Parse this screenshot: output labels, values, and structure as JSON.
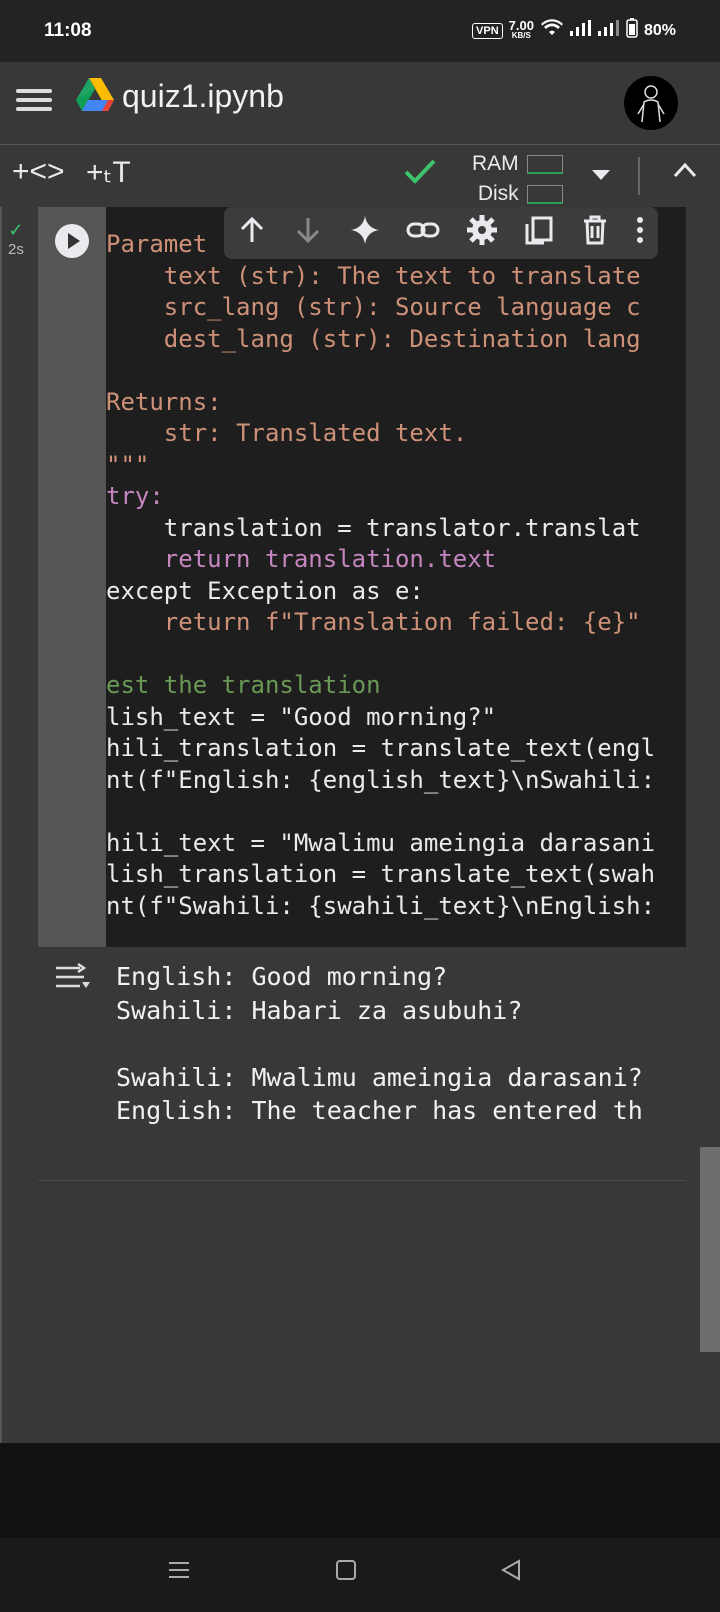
{
  "status_bar": {
    "time": "11:08",
    "vpn": "VPN",
    "speed_value": "7.00",
    "speed_unit": "KB/S",
    "battery": "80%"
  },
  "app_bar": {
    "title": "quiz1.ipynb",
    "icons": [
      "menu-icon",
      "google-drive-icon",
      "avatar"
    ]
  },
  "toolbar": {
    "add_code": "+<>",
    "add_text": "+ₜT",
    "ram_label": "RAM",
    "disk_label": "Disk",
    "status_icon": "check-icon",
    "status_color": "#3ec46d"
  },
  "cell": {
    "exec_time": "2s",
    "toolbar_icons": [
      "arrow-up-icon",
      "arrow-down-icon",
      "sparkle-icon",
      "link-icon",
      "gear-icon",
      "mirror-icon",
      "trash-icon",
      "more-vert-icon"
    ],
    "code_lines": [
      "Paramet",
      "    text (str): The text to translate",
      "    src_lang (str): Source language c",
      "    dest_lang (str): Destination lang",
      "",
      "Returns:",
      "    str: Translated text.",
      "\"\"\"",
      "try:",
      "    translation = translator.translat",
      "    return translation.text",
      "except Exception as e:",
      "    return f\"Translation failed: {e}\"",
      "",
      "est the translation",
      "lish_text = \"Good morning?\"",
      "hili_translation = translate_text(engl",
      "nt(f\"English: {english_text}\\nSwahili:",
      "",
      "hili_text = \"Mwalimu ameingia darasani",
      "lish_translation = translate_text(swah",
      "nt(f\"Swahili: {swahili_text}\\nEnglish:"
    ]
  },
  "output": {
    "line1": "English: Good morning?",
    "line2": "Swahili: Habari za asubuhi?",
    "line3": "Swahili: Mwalimu ameingia darasani?",
    "line4": "English: The teacher has entered th"
  }
}
